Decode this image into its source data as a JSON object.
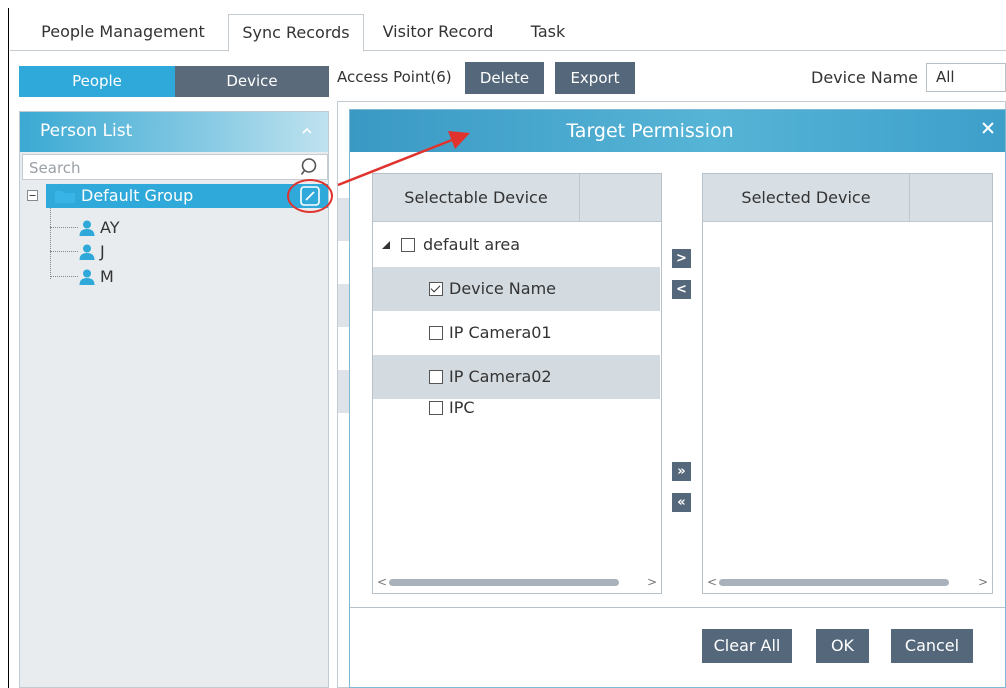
{
  "tabs": [
    "People Management",
    "Sync Records",
    "Visitor Record",
    "Task"
  ],
  "active_tab": "Sync Records",
  "toggle": {
    "people": "People",
    "device": "Device"
  },
  "person_list": {
    "title": "Person List",
    "search_placeholder": "Search",
    "group": "Default Group",
    "people": [
      "AY",
      "J",
      "M"
    ]
  },
  "toolbar": {
    "access_point": "Access Point(6)",
    "delete": "Delete",
    "export": "Export",
    "device_name_label": "Device Name",
    "device_name_value": "All"
  },
  "dialog": {
    "title": "Target Permission",
    "close": "×",
    "selectable_header": "Selectable Device",
    "selected_header": "Selected Device",
    "area": "default area",
    "devices": [
      {
        "name": "Device Name",
        "checked": true
      },
      {
        "name": "IP Camera01",
        "checked": false
      },
      {
        "name": "IP Camera02",
        "checked": false
      },
      {
        "name": "IPC",
        "checked": false
      }
    ],
    "move_right": ">",
    "move_left": "<",
    "move_all_right": "»",
    "move_all_left": "«",
    "clear_all": "Clear All",
    "ok": "OK",
    "cancel": "Cancel"
  },
  "colors": {
    "accent_blue": "#2ea9d9",
    "button_slate": "#55677a",
    "annotation_red": "#e0332e"
  }
}
